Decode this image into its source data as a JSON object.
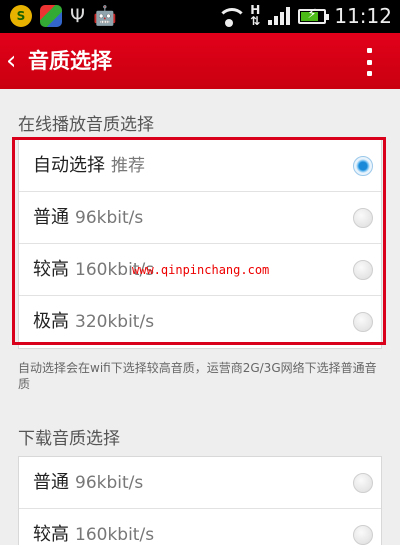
{
  "status_bar": {
    "app1": "S",
    "app2": "",
    "usb_glyph": "Ψ",
    "android_glyph": "🤖",
    "network_letter": "H",
    "time": "11:12",
    "icons": [
      "app-icon",
      "color-app-icon",
      "usb-icon",
      "android-debug-icon",
      "wifi-icon",
      "hspa-icon",
      "signal-icon",
      "battery-charging-icon"
    ]
  },
  "header": {
    "back_glyph": "‹",
    "title": "音质选择",
    "accent_color": "#d9001b"
  },
  "online": {
    "header": "在线播放音质选择",
    "options": [
      {
        "label": "自动选择",
        "sub": "推荐",
        "checked": true
      },
      {
        "label": "普通",
        "sub": "96kbit/s",
        "checked": false
      },
      {
        "label": "较高",
        "sub": "160kbit/s",
        "checked": false
      },
      {
        "label": "极高",
        "sub": "320kbit/s",
        "checked": false
      }
    ],
    "note": "自动选择会在wifi下选择较高音质，运营商2G/3G网络下选择普通音质"
  },
  "download": {
    "header": "下载音质选择",
    "options": [
      {
        "label": "普通",
        "sub": "96kbit/s",
        "checked": false
      },
      {
        "label": "较高",
        "sub": "160kbit/s",
        "checked": false
      }
    ]
  },
  "watermark": "www.qinpinchang.com"
}
